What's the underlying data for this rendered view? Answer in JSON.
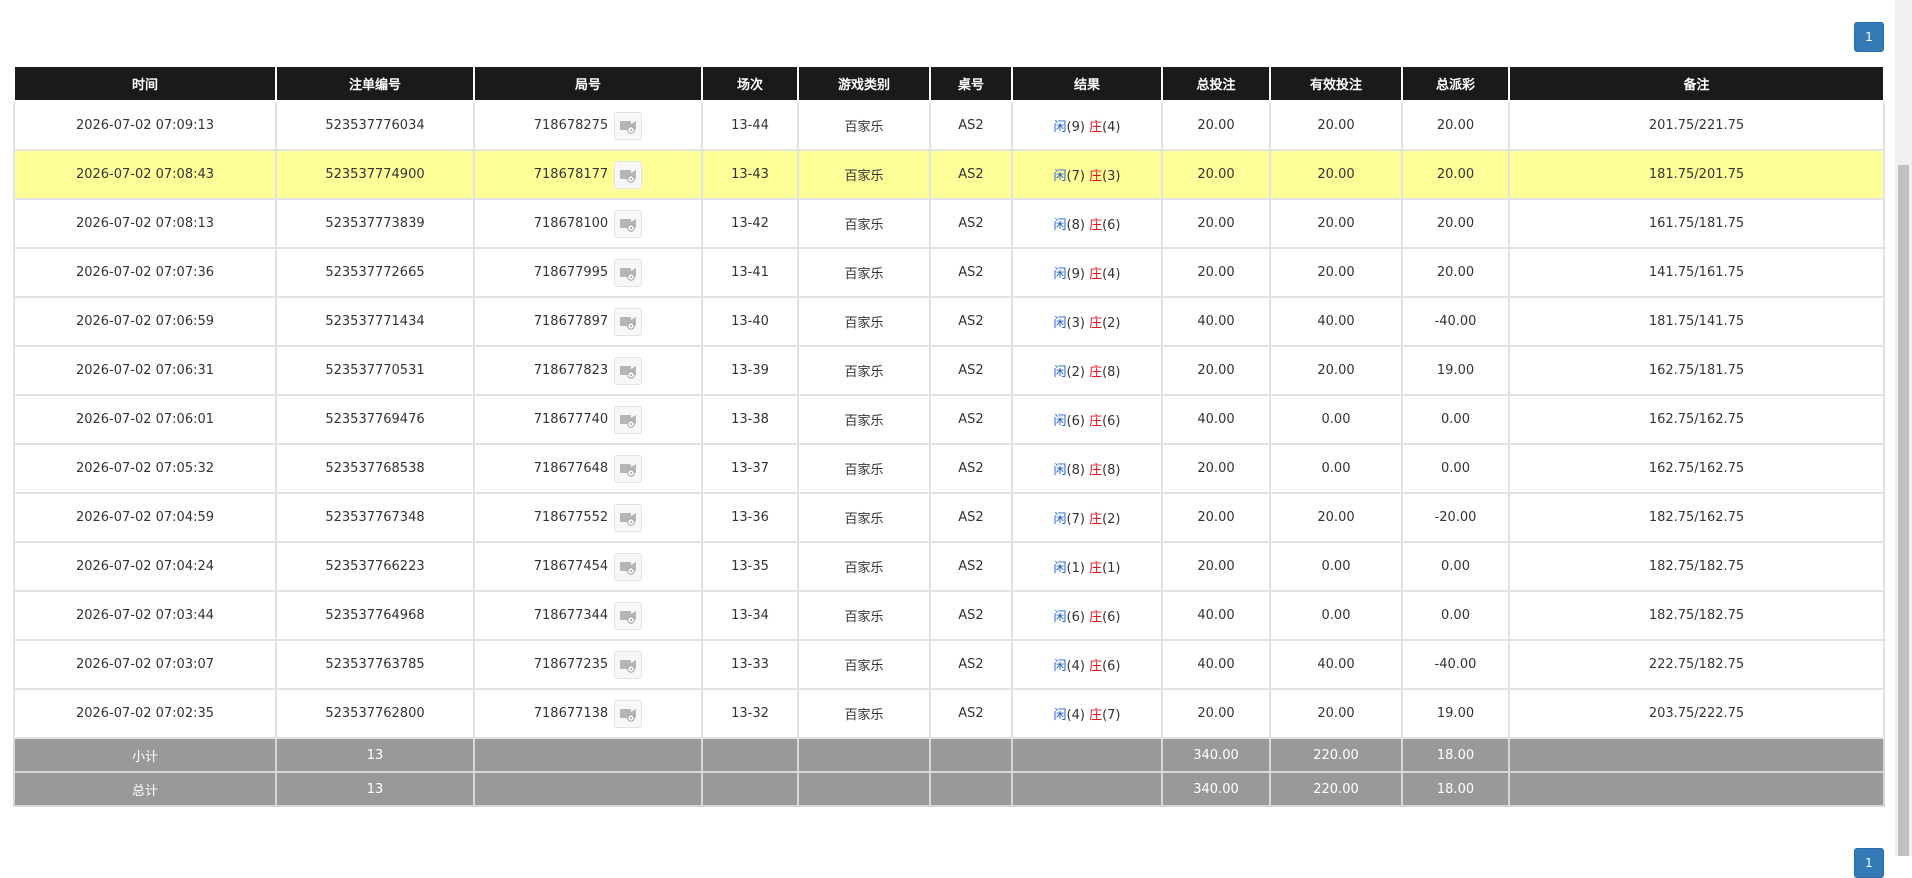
{
  "pagination": {
    "current_page": "1"
  },
  "table": {
    "headers": [
      "时间",
      "注单编号",
      "局号",
      "场次",
      "游戏类别",
      "桌号",
      "结果",
      "总投注",
      "有效投注",
      "总派彩",
      "备注"
    ],
    "rows": [
      {
        "time": "2026-07-02 07:09:13",
        "bet_id": "523537776034",
        "round": "718678275",
        "session": "13-44",
        "game": "百家乐",
        "table": "AS2",
        "player_label": "闲",
        "player_val": "(9)",
        "banker_label": "庄",
        "banker_val": "(4)",
        "total_bet": "20.00",
        "valid_bet": "20.00",
        "payout": "20.00",
        "payout_neg": false,
        "note": "201.75/221.75",
        "highlight": false
      },
      {
        "time": "2026-07-02 07:08:43",
        "bet_id": "523537774900",
        "round": "718678177",
        "session": "13-43",
        "game": "百家乐",
        "table": "AS2",
        "player_label": "闲",
        "player_val": "(7)",
        "banker_label": "庄",
        "banker_val": "(3)",
        "total_bet": "20.00",
        "valid_bet": "20.00",
        "payout": "20.00",
        "payout_neg": false,
        "note": "181.75/201.75",
        "highlight": true
      },
      {
        "time": "2026-07-02 07:08:13",
        "bet_id": "523537773839",
        "round": "718678100",
        "session": "13-42",
        "game": "百家乐",
        "table": "AS2",
        "player_label": "闲",
        "player_val": "(8)",
        "banker_label": "庄",
        "banker_val": "(6)",
        "total_bet": "20.00",
        "valid_bet": "20.00",
        "payout": "20.00",
        "payout_neg": false,
        "note": "161.75/181.75",
        "highlight": false
      },
      {
        "time": "2026-07-02 07:07:36",
        "bet_id": "523537772665",
        "round": "718677995",
        "session": "13-41",
        "game": "百家乐",
        "table": "AS2",
        "player_label": "闲",
        "player_val": "(9)",
        "banker_label": "庄",
        "banker_val": "(4)",
        "total_bet": "20.00",
        "valid_bet": "20.00",
        "payout": "20.00",
        "payout_neg": false,
        "note": "141.75/161.75",
        "highlight": false
      },
      {
        "time": "2026-07-02 07:06:59",
        "bet_id": "523537771434",
        "round": "718677897",
        "session": "13-40",
        "game": "百家乐",
        "table": "AS2",
        "player_label": "闲",
        "player_val": "(3)",
        "banker_label": "庄",
        "banker_val": "(2)",
        "total_bet": "40.00",
        "valid_bet": "40.00",
        "payout": "-40.00",
        "payout_neg": true,
        "note": "181.75/141.75",
        "highlight": false
      },
      {
        "time": "2026-07-02 07:06:31",
        "bet_id": "523537770531",
        "round": "718677823",
        "session": "13-39",
        "game": "百家乐",
        "table": "AS2",
        "player_label": "闲",
        "player_val": "(2)",
        "banker_label": "庄",
        "banker_val": "(8)",
        "total_bet": "20.00",
        "valid_bet": "20.00",
        "payout": "19.00",
        "payout_neg": false,
        "note": "162.75/181.75",
        "highlight": false
      },
      {
        "time": "2026-07-02 07:06:01",
        "bet_id": "523537769476",
        "round": "718677740",
        "session": "13-38",
        "game": "百家乐",
        "table": "AS2",
        "player_label": "闲",
        "player_val": "(6)",
        "banker_label": "庄",
        "banker_val": "(6)",
        "total_bet": "40.00",
        "valid_bet": "0.00",
        "payout": "0.00",
        "payout_neg": false,
        "note": "162.75/162.75",
        "highlight": false
      },
      {
        "time": "2026-07-02 07:05:32",
        "bet_id": "523537768538",
        "round": "718677648",
        "session": "13-37",
        "game": "百家乐",
        "table": "AS2",
        "player_label": "闲",
        "player_val": "(8)",
        "banker_label": "庄",
        "banker_val": "(8)",
        "total_bet": "20.00",
        "valid_bet": "0.00",
        "payout": "0.00",
        "payout_neg": false,
        "note": "162.75/162.75",
        "highlight": false
      },
      {
        "time": "2026-07-02 07:04:59",
        "bet_id": "523537767348",
        "round": "718677552",
        "session": "13-36",
        "game": "百家乐",
        "table": "AS2",
        "player_label": "闲",
        "player_val": "(7)",
        "banker_label": "庄",
        "banker_val": "(2)",
        "total_bet": "20.00",
        "valid_bet": "20.00",
        "payout": "-20.00",
        "payout_neg": true,
        "note": "182.75/162.75",
        "highlight": false
      },
      {
        "time": "2026-07-02 07:04:24",
        "bet_id": "523537766223",
        "round": "718677454",
        "session": "13-35",
        "game": "百家乐",
        "table": "AS2",
        "player_label": "闲",
        "player_val": "(1)",
        "banker_label": "庄",
        "banker_val": "(1)",
        "total_bet": "20.00",
        "valid_bet": "0.00",
        "payout": "0.00",
        "payout_neg": false,
        "note": "182.75/182.75",
        "highlight": false
      },
      {
        "time": "2026-07-02 07:03:44",
        "bet_id": "523537764968",
        "round": "718677344",
        "session": "13-34",
        "game": "百家乐",
        "table": "AS2",
        "player_label": "闲",
        "player_val": "(6)",
        "banker_label": "庄",
        "banker_val": "(6)",
        "total_bet": "40.00",
        "valid_bet": "0.00",
        "payout": "0.00",
        "payout_neg": false,
        "note": "182.75/182.75",
        "highlight": false
      },
      {
        "time": "2026-07-02 07:03:07",
        "bet_id": "523537763785",
        "round": "718677235",
        "session": "13-33",
        "game": "百家乐",
        "table": "AS2",
        "player_label": "闲",
        "player_val": "(4)",
        "banker_label": "庄",
        "banker_val": "(6)",
        "total_bet": "40.00",
        "valid_bet": "40.00",
        "payout": "-40.00",
        "payout_neg": true,
        "note": "222.75/182.75",
        "highlight": false
      },
      {
        "time": "2026-07-02 07:02:35",
        "bet_id": "523537762800",
        "round": "718677138",
        "session": "13-32",
        "game": "百家乐",
        "table": "AS2",
        "player_label": "闲",
        "player_val": "(4)",
        "banker_label": "庄",
        "banker_val": "(7)",
        "total_bet": "20.00",
        "valid_bet": "20.00",
        "payout": "19.00",
        "payout_neg": false,
        "note": "203.75/222.75",
        "highlight": false
      }
    ],
    "subtotal": {
      "label": "小计",
      "count": "13",
      "total_bet": "340.00",
      "valid_bet": "220.00",
      "payout": "18.00"
    },
    "total": {
      "label": "总计",
      "count": "13",
      "total_bet": "340.00",
      "valid_bet": "220.00",
      "payout": "18.00"
    }
  },
  "colors": {
    "header_bg": "#1a1a1a",
    "highlight_row": "#ffff99",
    "footer_bg": "#999999",
    "bet_blue": "#1a5fd6",
    "loss_red": "#e0141e",
    "page_button": "#337ab7"
  },
  "icons": {
    "replay": "video-replay-icon"
  }
}
